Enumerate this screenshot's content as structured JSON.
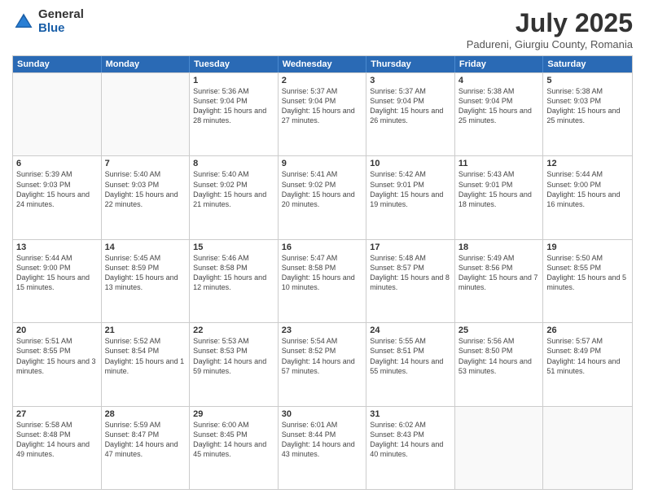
{
  "logo": {
    "general": "General",
    "blue": "Blue"
  },
  "header": {
    "month": "July 2025",
    "location": "Padureni, Giurgiu County, Romania"
  },
  "weekdays": [
    "Sunday",
    "Monday",
    "Tuesday",
    "Wednesday",
    "Thursday",
    "Friday",
    "Saturday"
  ],
  "rows": [
    [
      {
        "day": "",
        "info": ""
      },
      {
        "day": "",
        "info": ""
      },
      {
        "day": "1",
        "info": "Sunrise: 5:36 AM\nSunset: 9:04 PM\nDaylight: 15 hours and 28 minutes."
      },
      {
        "day": "2",
        "info": "Sunrise: 5:37 AM\nSunset: 9:04 PM\nDaylight: 15 hours and 27 minutes."
      },
      {
        "day": "3",
        "info": "Sunrise: 5:37 AM\nSunset: 9:04 PM\nDaylight: 15 hours and 26 minutes."
      },
      {
        "day": "4",
        "info": "Sunrise: 5:38 AM\nSunset: 9:04 PM\nDaylight: 15 hours and 25 minutes."
      },
      {
        "day": "5",
        "info": "Sunrise: 5:38 AM\nSunset: 9:03 PM\nDaylight: 15 hours and 25 minutes."
      }
    ],
    [
      {
        "day": "6",
        "info": "Sunrise: 5:39 AM\nSunset: 9:03 PM\nDaylight: 15 hours and 24 minutes."
      },
      {
        "day": "7",
        "info": "Sunrise: 5:40 AM\nSunset: 9:03 PM\nDaylight: 15 hours and 22 minutes."
      },
      {
        "day": "8",
        "info": "Sunrise: 5:40 AM\nSunset: 9:02 PM\nDaylight: 15 hours and 21 minutes."
      },
      {
        "day": "9",
        "info": "Sunrise: 5:41 AM\nSunset: 9:02 PM\nDaylight: 15 hours and 20 minutes."
      },
      {
        "day": "10",
        "info": "Sunrise: 5:42 AM\nSunset: 9:01 PM\nDaylight: 15 hours and 19 minutes."
      },
      {
        "day": "11",
        "info": "Sunrise: 5:43 AM\nSunset: 9:01 PM\nDaylight: 15 hours and 18 minutes."
      },
      {
        "day": "12",
        "info": "Sunrise: 5:44 AM\nSunset: 9:00 PM\nDaylight: 15 hours and 16 minutes."
      }
    ],
    [
      {
        "day": "13",
        "info": "Sunrise: 5:44 AM\nSunset: 9:00 PM\nDaylight: 15 hours and 15 minutes."
      },
      {
        "day": "14",
        "info": "Sunrise: 5:45 AM\nSunset: 8:59 PM\nDaylight: 15 hours and 13 minutes."
      },
      {
        "day": "15",
        "info": "Sunrise: 5:46 AM\nSunset: 8:58 PM\nDaylight: 15 hours and 12 minutes."
      },
      {
        "day": "16",
        "info": "Sunrise: 5:47 AM\nSunset: 8:58 PM\nDaylight: 15 hours and 10 minutes."
      },
      {
        "day": "17",
        "info": "Sunrise: 5:48 AM\nSunset: 8:57 PM\nDaylight: 15 hours and 8 minutes."
      },
      {
        "day": "18",
        "info": "Sunrise: 5:49 AM\nSunset: 8:56 PM\nDaylight: 15 hours and 7 minutes."
      },
      {
        "day": "19",
        "info": "Sunrise: 5:50 AM\nSunset: 8:55 PM\nDaylight: 15 hours and 5 minutes."
      }
    ],
    [
      {
        "day": "20",
        "info": "Sunrise: 5:51 AM\nSunset: 8:55 PM\nDaylight: 15 hours and 3 minutes."
      },
      {
        "day": "21",
        "info": "Sunrise: 5:52 AM\nSunset: 8:54 PM\nDaylight: 15 hours and 1 minute."
      },
      {
        "day": "22",
        "info": "Sunrise: 5:53 AM\nSunset: 8:53 PM\nDaylight: 14 hours and 59 minutes."
      },
      {
        "day": "23",
        "info": "Sunrise: 5:54 AM\nSunset: 8:52 PM\nDaylight: 14 hours and 57 minutes."
      },
      {
        "day": "24",
        "info": "Sunrise: 5:55 AM\nSunset: 8:51 PM\nDaylight: 14 hours and 55 minutes."
      },
      {
        "day": "25",
        "info": "Sunrise: 5:56 AM\nSunset: 8:50 PM\nDaylight: 14 hours and 53 minutes."
      },
      {
        "day": "26",
        "info": "Sunrise: 5:57 AM\nSunset: 8:49 PM\nDaylight: 14 hours and 51 minutes."
      }
    ],
    [
      {
        "day": "27",
        "info": "Sunrise: 5:58 AM\nSunset: 8:48 PM\nDaylight: 14 hours and 49 minutes."
      },
      {
        "day": "28",
        "info": "Sunrise: 5:59 AM\nSunset: 8:47 PM\nDaylight: 14 hours and 47 minutes."
      },
      {
        "day": "29",
        "info": "Sunrise: 6:00 AM\nSunset: 8:45 PM\nDaylight: 14 hours and 45 minutes."
      },
      {
        "day": "30",
        "info": "Sunrise: 6:01 AM\nSunset: 8:44 PM\nDaylight: 14 hours and 43 minutes."
      },
      {
        "day": "31",
        "info": "Sunrise: 6:02 AM\nSunset: 8:43 PM\nDaylight: 14 hours and 40 minutes."
      },
      {
        "day": "",
        "info": ""
      },
      {
        "day": "",
        "info": ""
      }
    ]
  ]
}
